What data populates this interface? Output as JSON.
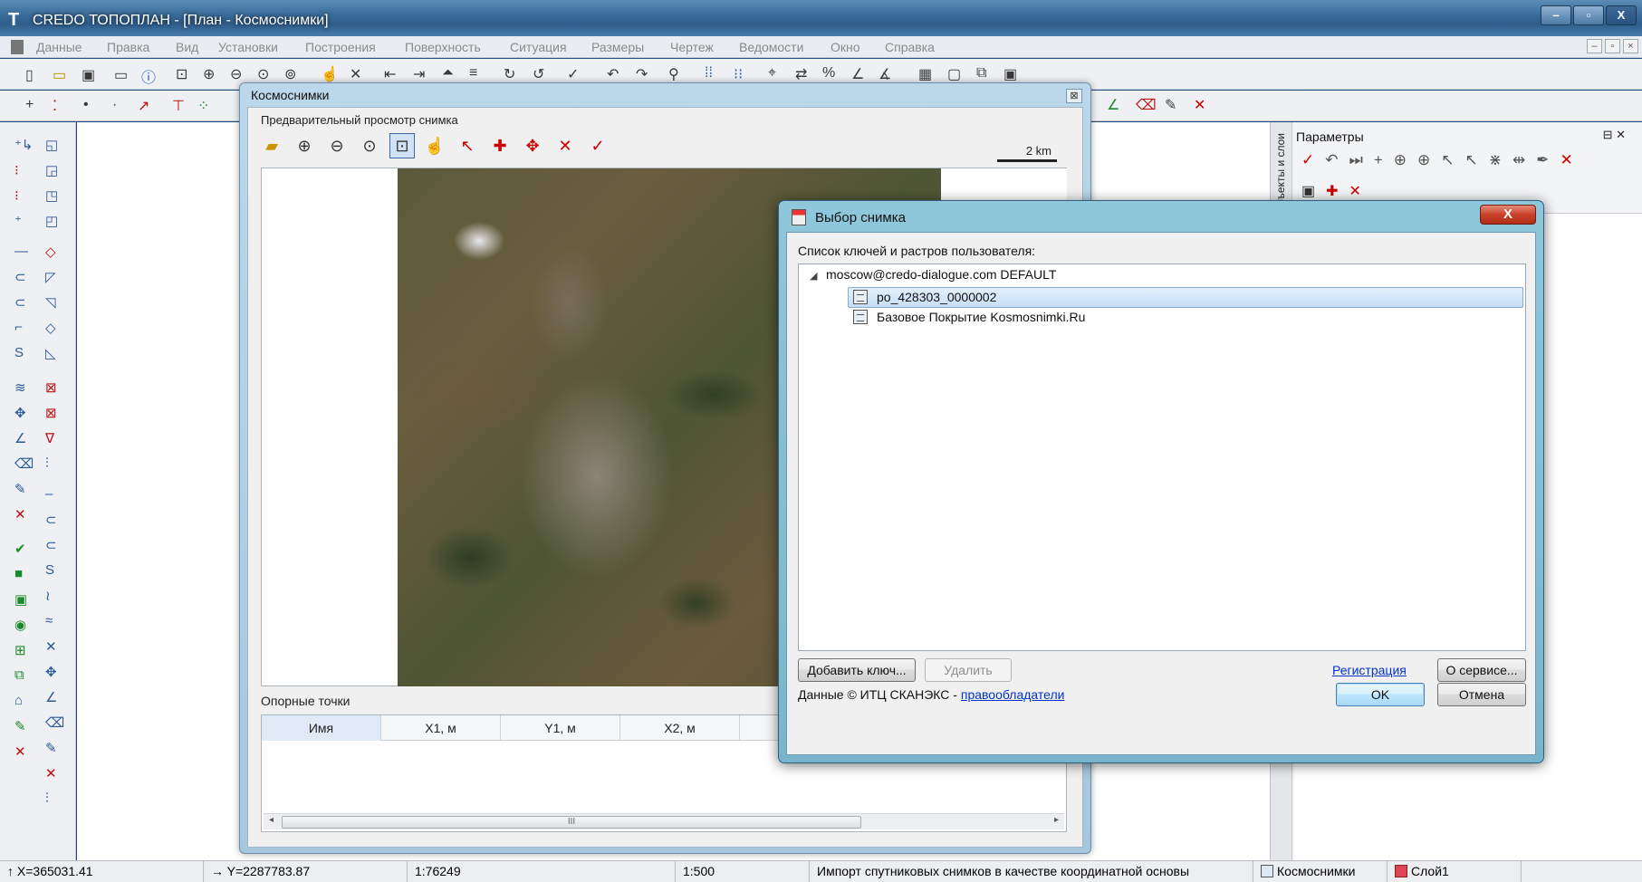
{
  "app": {
    "title": "CREDO ТОПОПЛАН - [План - Космоснимки]",
    "menu": [
      "Данные",
      "Правка",
      "Вид",
      "Установки",
      "Построения",
      "Поверхность",
      "Ситуация",
      "Размеры",
      "Чертеж",
      "Ведомости",
      "Окно",
      "Справка"
    ],
    "window_buttons": {
      "minimize": "–",
      "maximize": "▫",
      "close": "X"
    }
  },
  "params_panel": {
    "title": "Параметры",
    "vertical_tab": "Объекты и слои"
  },
  "kosmosnimki_window": {
    "title": "Космоснимки",
    "preview_label": "Предварительный просмотр снимка",
    "scale_label": "2 km",
    "control_points_label": "Опорные точки",
    "table_columns": [
      "Имя",
      "X1, м",
      "Y1, м",
      "X2, м"
    ],
    "scroll_grip": "III"
  },
  "select_dialog": {
    "title": "Выбор снимка",
    "close_label": "X",
    "list_label": "Список ключей и растров пользователя:",
    "tree": {
      "root": "moscow@credo-dialogue.com DEFAULT",
      "items": [
        {
          "label": "po_428303_0000002",
          "selected": true
        },
        {
          "label": "Базовое Покрытие Kosmosnimki.Ru",
          "selected": false
        }
      ]
    },
    "buttons": {
      "add_key": "Добавить ключ...",
      "delete": "Удалить",
      "about": "О сервисе...",
      "ok": "OK",
      "cancel": "Отмена"
    },
    "registration_link": "Регистрация",
    "copyright_prefix": "Данные © ИТЦ СКАНЭКС - ",
    "copyright_link": "правообладатели"
  },
  "status_bar": {
    "x_coord": "↑ X=365031.41",
    "y_coord": "→ Y=2287783.87",
    "scale1": "1:76249",
    "scale2": "1:500",
    "message": "Импорт спутниковых снимков в качестве координатной основы",
    "plan_label": "Космоснимки",
    "layer_label": "Слой1"
  }
}
